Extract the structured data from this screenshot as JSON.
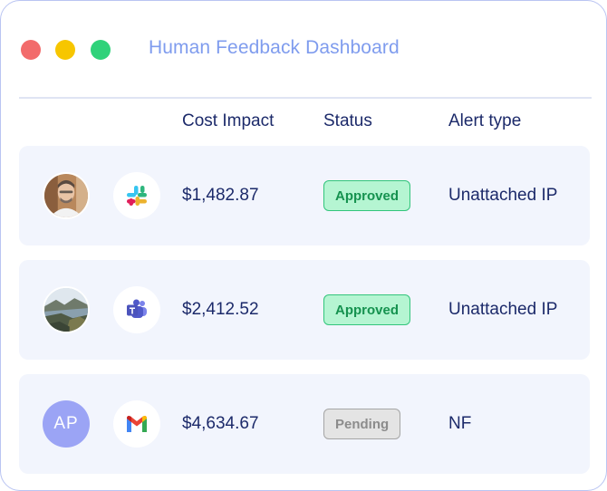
{
  "window": {
    "title": "Human Feedback Dashboard"
  },
  "columns": {
    "cost": "Cost Impact",
    "status": "Status",
    "alert": "Alert type"
  },
  "rows": [
    {
      "avatar": "person-photo",
      "app": "slack-icon",
      "cost": "$1,482.87",
      "status": "Approved",
      "alert": "Unattached IP"
    },
    {
      "avatar": "landscape-photo",
      "app": "teams-icon",
      "cost": "$2,412.52",
      "status": "Approved",
      "alert": "Unattached IP"
    },
    {
      "avatar": "initials",
      "initials": "AP",
      "app": "gmail-icon",
      "cost": "$4,634.67",
      "status": "Pending",
      "alert": "NF"
    }
  ],
  "colors": {
    "approved_bg": "#b5f5d2",
    "approved_text": "#15924f",
    "pending_bg": "#e4e4e4",
    "pending_text": "#8c8c8c",
    "title": "#7f9cee",
    "text": "#1c2a6a"
  }
}
